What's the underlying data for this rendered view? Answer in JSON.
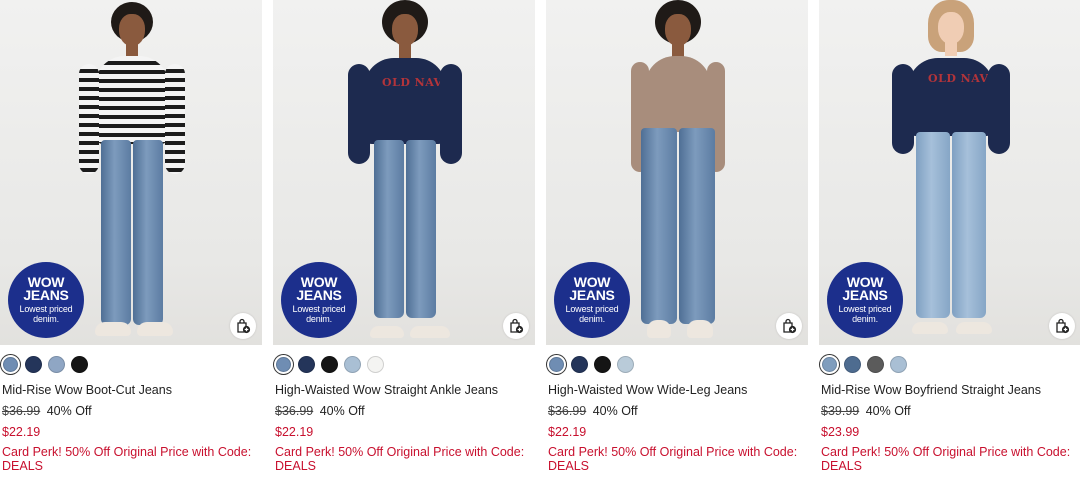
{
  "badge": {
    "line1": "WOW",
    "line2": "JEANS",
    "line3": "Lowest priced denim."
  },
  "products": [
    {
      "name": "Mid-Rise Wow Boot-Cut Jeans",
      "original_price": "$36.99",
      "discount": "40% Off",
      "sale_price": "$22.19",
      "perk": "Card Perk! 50% Off Original Price with Code: DEALS",
      "swatches": [
        "#6f8db3",
        "#24355a",
        "#8fa6c4",
        "#151515"
      ],
      "top": "stripes"
    },
    {
      "name": "High-Waisted Wow Straight Ankle Jeans",
      "original_price": "$36.99",
      "discount": "40% Off",
      "sale_price": "$22.19",
      "perk": "Card Perk! 50% Off Original Price with Code: DEALS",
      "swatches": [
        "#6f8db3",
        "#24355a",
        "#151515",
        "#a9bfd4",
        "#f4f4f2"
      ],
      "top": "navy"
    },
    {
      "name": "High-Waisted Wow Wide-Leg Jeans",
      "original_price": "$36.99",
      "discount": "40% Off",
      "sale_price": "$22.19",
      "perk": "Card Perk! 50% Off Original Price with Code: DEALS",
      "swatches": [
        "#6f8db3",
        "#24355a",
        "#151515",
        "#b9cbd9"
      ],
      "top": "tan"
    },
    {
      "name": "Mid-Rise Wow Boyfriend Straight Jeans",
      "original_price": "$39.99",
      "discount": "40% Off",
      "sale_price": "$23.99",
      "perk": "Card Perk! 50% Off Original Price with Code: DEALS",
      "swatches": [
        "#7f9dbd",
        "#4e6c90",
        "#5b5b5b",
        "#a9bfd4"
      ],
      "top": "navy"
    }
  ],
  "colors": {
    "badge_bg": "#1c2f8c",
    "sale_red": "#c8102e"
  },
  "icons": {
    "bag": "add-to-bag-icon"
  }
}
